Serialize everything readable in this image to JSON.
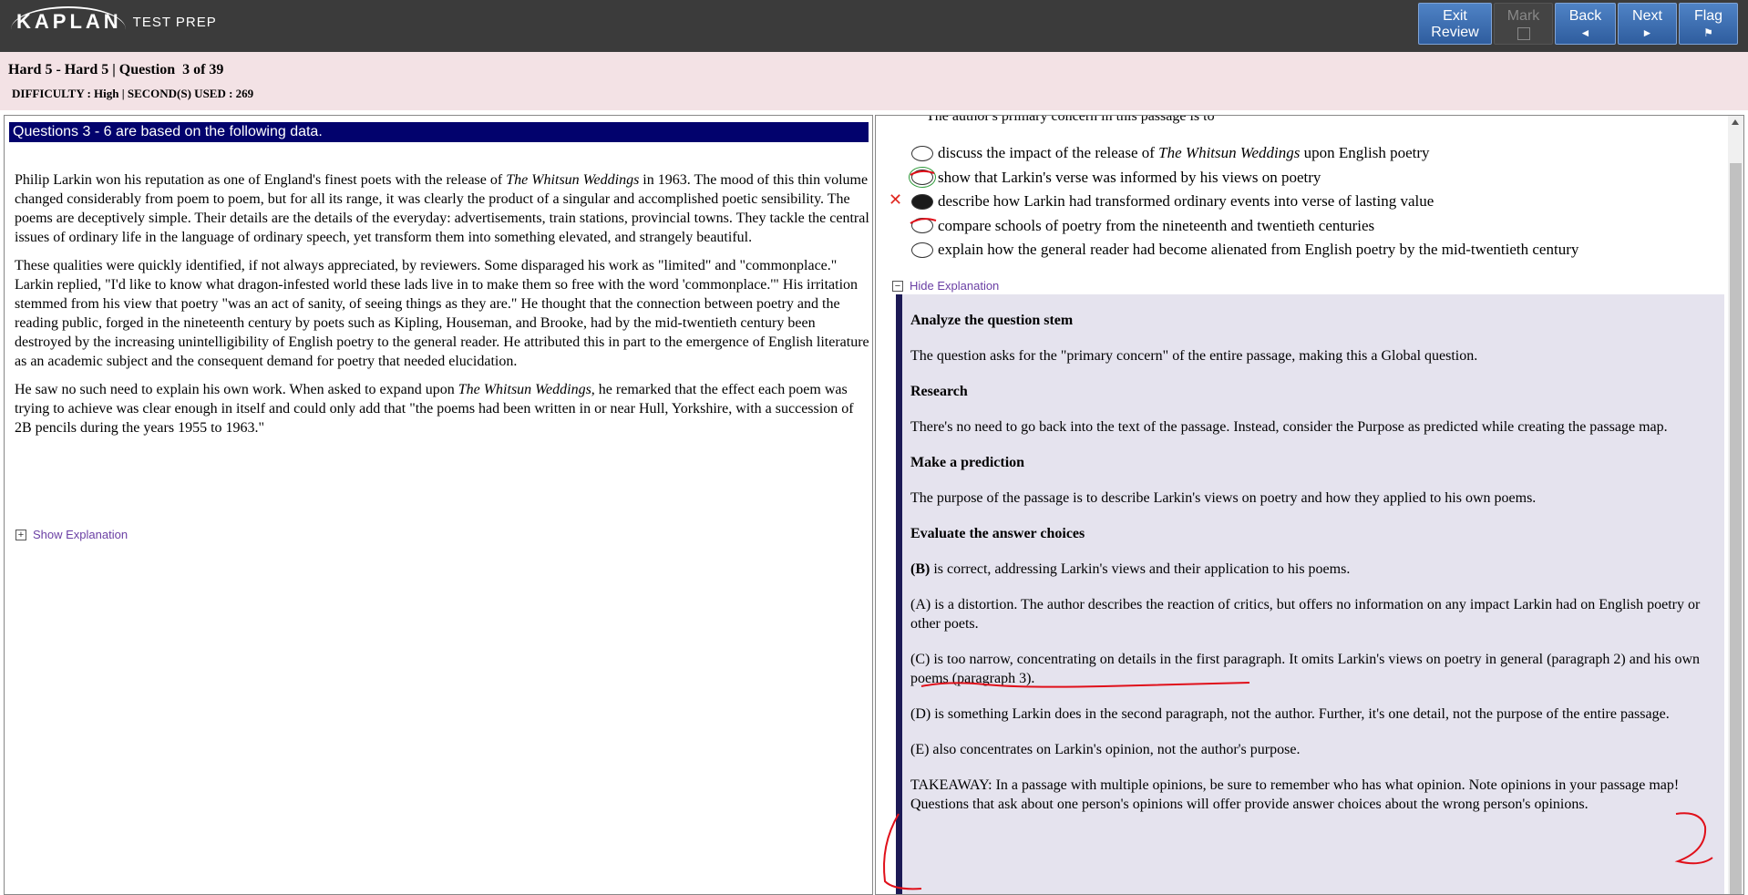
{
  "toolbar": {
    "logo": "KAPLAN",
    "logo_tag": "TEST PREP",
    "exit_label": "Exit",
    "exit_sub": "Review",
    "mark_label": "Mark",
    "back_label": "Back",
    "next_label": "Next",
    "flag_label": "Flag",
    "back_arrow": "◄",
    "next_arrow": "►",
    "flag_glyph": "⚑"
  },
  "header": {
    "title": "Hard 5 - Hard 5 | Question  3 of 39",
    "info": "DIFFICULTY : High | SECOND(S) USED : 269"
  },
  "passage": {
    "heading": "Questions 3 - 6 are based on the following data.",
    "p1_a": "Philip Larkin won his reputation as one of England's finest poets with the release of ",
    "p1_title": "The Whitsun Weddings",
    "p1_b": " in 1963. The mood of this thin volume changed considerably from poem to poem, but for all its range, it was clearly the product of a singular and accomplished poetic sensibility. The poems are deceptively simple. Their details are the details of the everyday: advertisements, train stations, provincial towns. They tackle the central issues of ordinary life in the language of ordinary speech, yet transform them into something elevated, and strangely beautiful.",
    "p2": "These qualities were quickly identified, if not always appreciated, by reviewers. Some disparaged his work as \"limited\" and \"commonplace.\" Larkin replied, \"I'd like to know what dragon-infested world these lads live in to make them so free with the word 'commonplace.'\" His irritation stemmed from his view that poetry \"was an act of sanity, of seeing things as they are.\" He thought that the connection between poetry and the reading public, forged in the nineteenth century by poets such as Kipling, Houseman, and Brooke, had by the mid-twentieth century been destroyed by the increasing unintelligibility of English poetry to the general reader. He attributed this in part to the emergence of English literature as an academic subject and the consequent demand for poetry that needed elucidation.",
    "p3_a": "He saw no such need to explain his own work. When asked to expand upon ",
    "p3_title": "The Whitsun Weddings",
    "p3_b": ", he remarked that the effect each poem was trying to achieve was clear enough in itself and could only add that \"the poems had been written in or near Hull, Yorkshire, with a succession of 2B pencils during the years 1955 to 1963.\"",
    "show_explanation": "Show Explanation"
  },
  "question": {
    "stem_cutoff": "The author's primary concern in this passage is to",
    "choices": [
      {
        "pre": "discuss the impact of the release of ",
        "title": "The Whitsun Weddings",
        "post": " upon English poetry"
      },
      {
        "pre": "show that Larkin's verse was informed by his views on poetry",
        "title": "",
        "post": ""
      },
      {
        "pre": "describe how Larkin had transformed ordinary events into verse of lasting value",
        "title": "",
        "post": ""
      },
      {
        "pre": "compare schools of poetry from the nineteenth and twentieth centuries",
        "title": "",
        "post": ""
      },
      {
        "pre": "explain how the general reader had become alienated from English poetry by the mid-twentieth century",
        "title": "",
        "post": ""
      }
    ],
    "selected_index": 2,
    "correct_index": 1,
    "wrong_mark": "✕",
    "hide_explanation": "Hide Explanation"
  },
  "explanation": {
    "h1": "Analyze the question stem",
    "t1": "The question asks for the \"primary concern\" of the entire passage, making this a Global question.",
    "h2": "Research",
    "t2": "There's no need to go back into the text of the passage. Instead, consider the Purpose as predicted while creating the passage map.",
    "h3": "Make a prediction",
    "t3": "The purpose of the passage is to describe Larkin's views on poetry and how they applied to his own poems.",
    "h4": "Evaluate the answer choices",
    "b_label": "(B)",
    "b_text": " is correct, addressing Larkin's views and their application to his poems.",
    "a_text": "(A) is a distortion. The author describes the reaction of critics, but offers no information on any impact Larkin had on English poetry or other poets.",
    "c_text": "(C) is too narrow, concentrating on details in the first paragraph. It omits Larkin's views on poetry in general (paragraph 2) and his own poems (paragraph 3).",
    "d_text": "(D) is something Larkin does in the second paragraph, not the author. Further, it's one detail, not the purpose of the entire passage.",
    "e_text": "(E) also concentrates on Larkin's opinion, not the author's purpose.",
    "takeaway": "TAKEAWAY: In a passage with multiple opinions, be sure to remember who has what opinion. Note opinions in your passage map! Questions that ask about one person's opinions will offer provide answer choices about the wrong person's opinions."
  },
  "colors": {
    "topbar": "#3b3b3b",
    "header_bg": "#f3e2e5",
    "passage_head_bg": "#02026d",
    "explanation_bg": "#e5e3ee",
    "link": "#6a3fa4",
    "annotation_ink": "#e0101a",
    "wrong": "#e0271f",
    "correct": "#2e9b3a"
  }
}
